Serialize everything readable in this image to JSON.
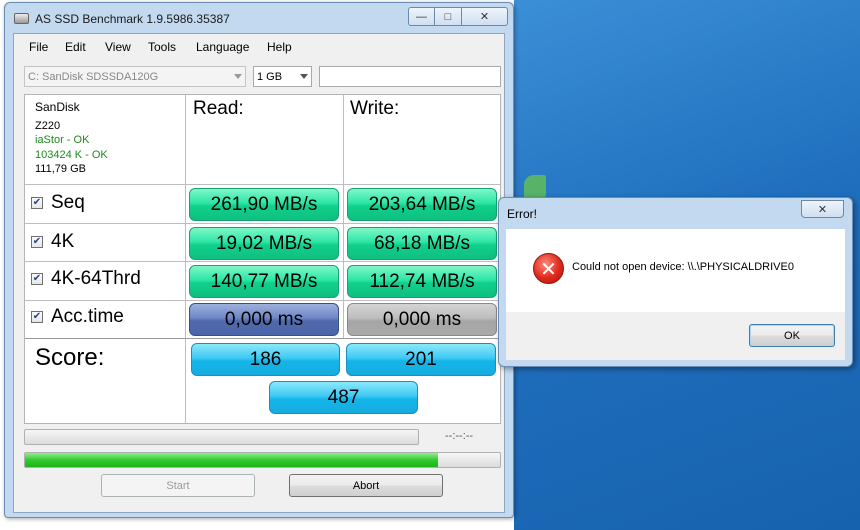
{
  "window": {
    "title": "AS SSD Benchmark 1.9.5986.35387",
    "min": "—",
    "max": "□",
    "close": "✕"
  },
  "menu": [
    "File",
    "Edit",
    "View",
    "Tools",
    "Language",
    "Help"
  ],
  "drive_select": {
    "value": "C: SanDisk SDSSDA120G"
  },
  "size_select": {
    "value": "1 GB"
  },
  "drive_info": {
    "vendor": "SanDisk",
    "firmware": "Z220",
    "driver": "iaStor - OK",
    "alignment": "103424 K - OK",
    "capacity": "111,79 GB"
  },
  "headers": {
    "read": "Read:",
    "write": "Write:"
  },
  "tests": [
    {
      "label": "Seq",
      "checked": true,
      "read": "261,90 MB/s",
      "write": "203,64 MB/s"
    },
    {
      "label": "4K",
      "checked": true,
      "read": "19,02 MB/s",
      "write": "68,18 MB/s"
    },
    {
      "label": "4K-64Thrd",
      "checked": true,
      "read": "140,77 MB/s",
      "write": "112,74 MB/s"
    },
    {
      "label": "Acc.time",
      "checked": true,
      "read": "0,000 ms",
      "write": "0,000 ms"
    }
  ],
  "check_mark": "✔",
  "score": {
    "label": "Score:",
    "read": "186",
    "write": "201",
    "total": "487"
  },
  "progress": {
    "time": "--:--:--",
    "top_fraction": 0.0,
    "bottom_fraction": 0.87
  },
  "buttons": {
    "start": "Start",
    "abort": "Abort"
  },
  "dialog": {
    "title": "Error!",
    "close": "✕",
    "icon": "✕",
    "message": "Could not open device: \\\\.\\PHYSICALDRIVE0",
    "ok": "OK"
  }
}
